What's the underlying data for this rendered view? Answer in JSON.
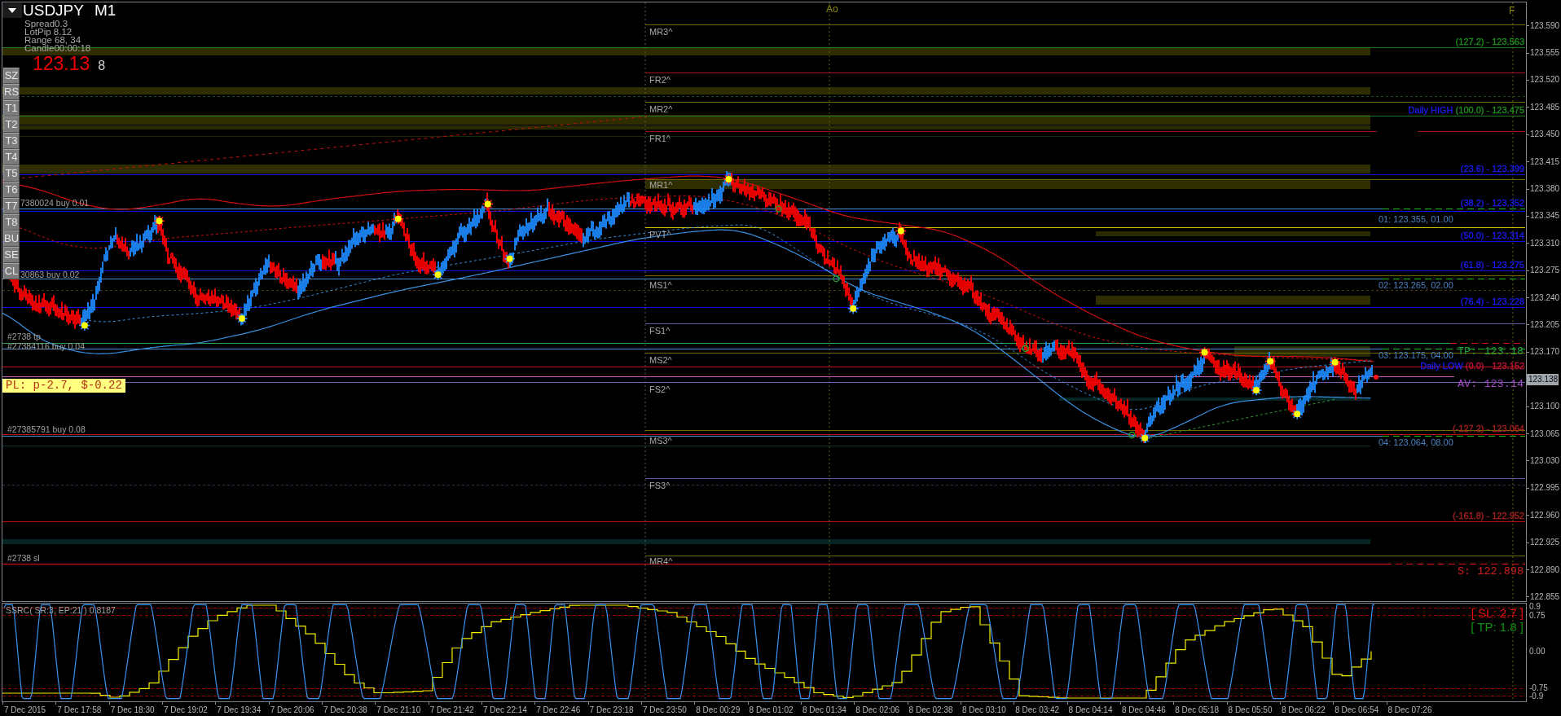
{
  "chart": {
    "symbol": "USDJPY",
    "timeframe": "M1"
  },
  "info_panel": {
    "lines": [
      "Spread0.3",
      "LotPip 8.12",
      "Range 68, 34",
      "Candle00:00:18"
    ],
    "price": "123.13",
    "price_suffix": "8"
  },
  "side_buttons": [
    "SZ",
    "RS",
    "T1",
    "T2",
    "T3",
    "T4",
    "T5",
    "T6",
    "T7",
    "T8",
    "BU",
    "SE",
    "CL"
  ],
  "time_markers": [
    "Ao",
    "F"
  ],
  "pivot_labels": [
    "MR3^",
    "FR2^",
    "MR2^",
    "FR1^",
    "MR1^",
    "PVT^",
    "MS1^",
    "FS1^",
    "MS2^",
    "FS2^",
    "MS3^",
    "FS3^",
    "MR4^"
  ],
  "fib_labels": [
    {
      "text": "(127.2) - 123.563",
      "color": "#1f8f1f"
    },
    {
      "tag": "Daily HIGH",
      "text": "(100.0) - 123.475",
      "color": "#1f8f1f"
    },
    {
      "text": "(23.6) - 123.399",
      "color": "#1c1cf0"
    },
    {
      "text": "(38.2) - 123.352",
      "color": "#1c1cf0"
    },
    {
      "text": "(50.0) - 123.314",
      "color": "#1c1cf0"
    },
    {
      "text": "(61.8) - 123.275",
      "color": "#1c1cf0"
    },
    {
      "text": "(76.4) - 123.228",
      "color": "#1c1cf0"
    },
    {
      "tag": "Daily LOW",
      "text": "(0.0) - 123.152",
      "color": "#c0143c"
    },
    {
      "text": "(-127.2) - 123.064",
      "color": "#a82020"
    },
    {
      "text": "(-161.8) - 122.952",
      "color": "#a82020"
    }
  ],
  "order_labels": [
    "01: 123.355, 01.00",
    "02: 123.265, 02.00",
    "03: 123.175, 04.00",
    "04: 123.064, 08.00"
  ],
  "trade_labels": [
    "7380024 buy 0.01",
    "30863 buy 0.02",
    "#2738 tp",
    "#27384116 buy 0.04",
    "#27385791 buy 0.08",
    "#2738 sl"
  ],
  "profit_loss": "PL: p-2.7, $-0.22",
  "level_tags": [
    {
      "kind": "take_profit",
      "text": "TP: 123.18"
    },
    {
      "kind": "average",
      "text": "AV: 123.14"
    },
    {
      "kind": "stop",
      "text": "S: 122.898"
    }
  ],
  "price_axis": [
    {
      "label": "123.590",
      "kind": "tick"
    },
    {
      "label": "123.555",
      "kind": "tick"
    },
    {
      "label": "123.520",
      "kind": "tick"
    },
    {
      "label": "123.485",
      "kind": "tick"
    },
    {
      "label": "123.450",
      "kind": "tick"
    },
    {
      "label": "123.415",
      "kind": "tick"
    },
    {
      "label": "123.380",
      "kind": "tick"
    },
    {
      "label": "123.345",
      "kind": "tick"
    },
    {
      "label": "123.310",
      "kind": "tick"
    },
    {
      "label": "123.275",
      "kind": "tick"
    },
    {
      "label": "123.240",
      "kind": "tick"
    },
    {
      "label": "123.205",
      "kind": "tick"
    },
    {
      "label": "123.170",
      "kind": "tick"
    },
    {
      "label": "123.138",
      "kind": "current"
    },
    {
      "label": "123.100",
      "kind": "tick"
    },
    {
      "label": "123.065",
      "kind": "tick"
    },
    {
      "label": "123.030",
      "kind": "tick"
    },
    {
      "label": "122.995",
      "kind": "tick"
    },
    {
      "label": "122.960",
      "kind": "tick"
    },
    {
      "label": "122.925",
      "kind": "tick"
    },
    {
      "label": "122.890",
      "kind": "tick"
    },
    {
      "label": "122.855",
      "kind": "tick"
    }
  ],
  "indicator": {
    "title": "SSRC( SR:3, EP:21 ) 0.8187",
    "stop_loss": "[ SL: 2.7 ]",
    "take_profit": "[ TP: 1.8 ]",
    "ticks": [
      "0.9",
      "0.75",
      "0.00",
      "-0.75",
      "-0.9"
    ]
  },
  "time_axis": [
    "7 Dec 2015",
    "7 Dec 17:58",
    "7 Dec 18:30",
    "7 Dec 19:02",
    "7 Dec 19:34",
    "7 Dec 20:06",
    "7 Dec 20:38",
    "7 Dec 21:10",
    "7 Dec 21:42",
    "7 Dec 22:14",
    "7 Dec 22:46",
    "7 Dec 23:18",
    "7 Dec 23:50",
    "8 Dec 00:29",
    "8 Dec 01:02",
    "8 Dec 01:34",
    "8 Dec 02:06",
    "8 Dec 02:38",
    "8 Dec 03:10",
    "8 Dec 03:42",
    "8 Dec 04:14",
    "8 Dec 04:46",
    "8 Dec 05:18",
    "8 Dec 05:50",
    "8 Dec 06:22",
    "8 Dec 06:54",
    "8 Dec 07:26"
  ]
}
